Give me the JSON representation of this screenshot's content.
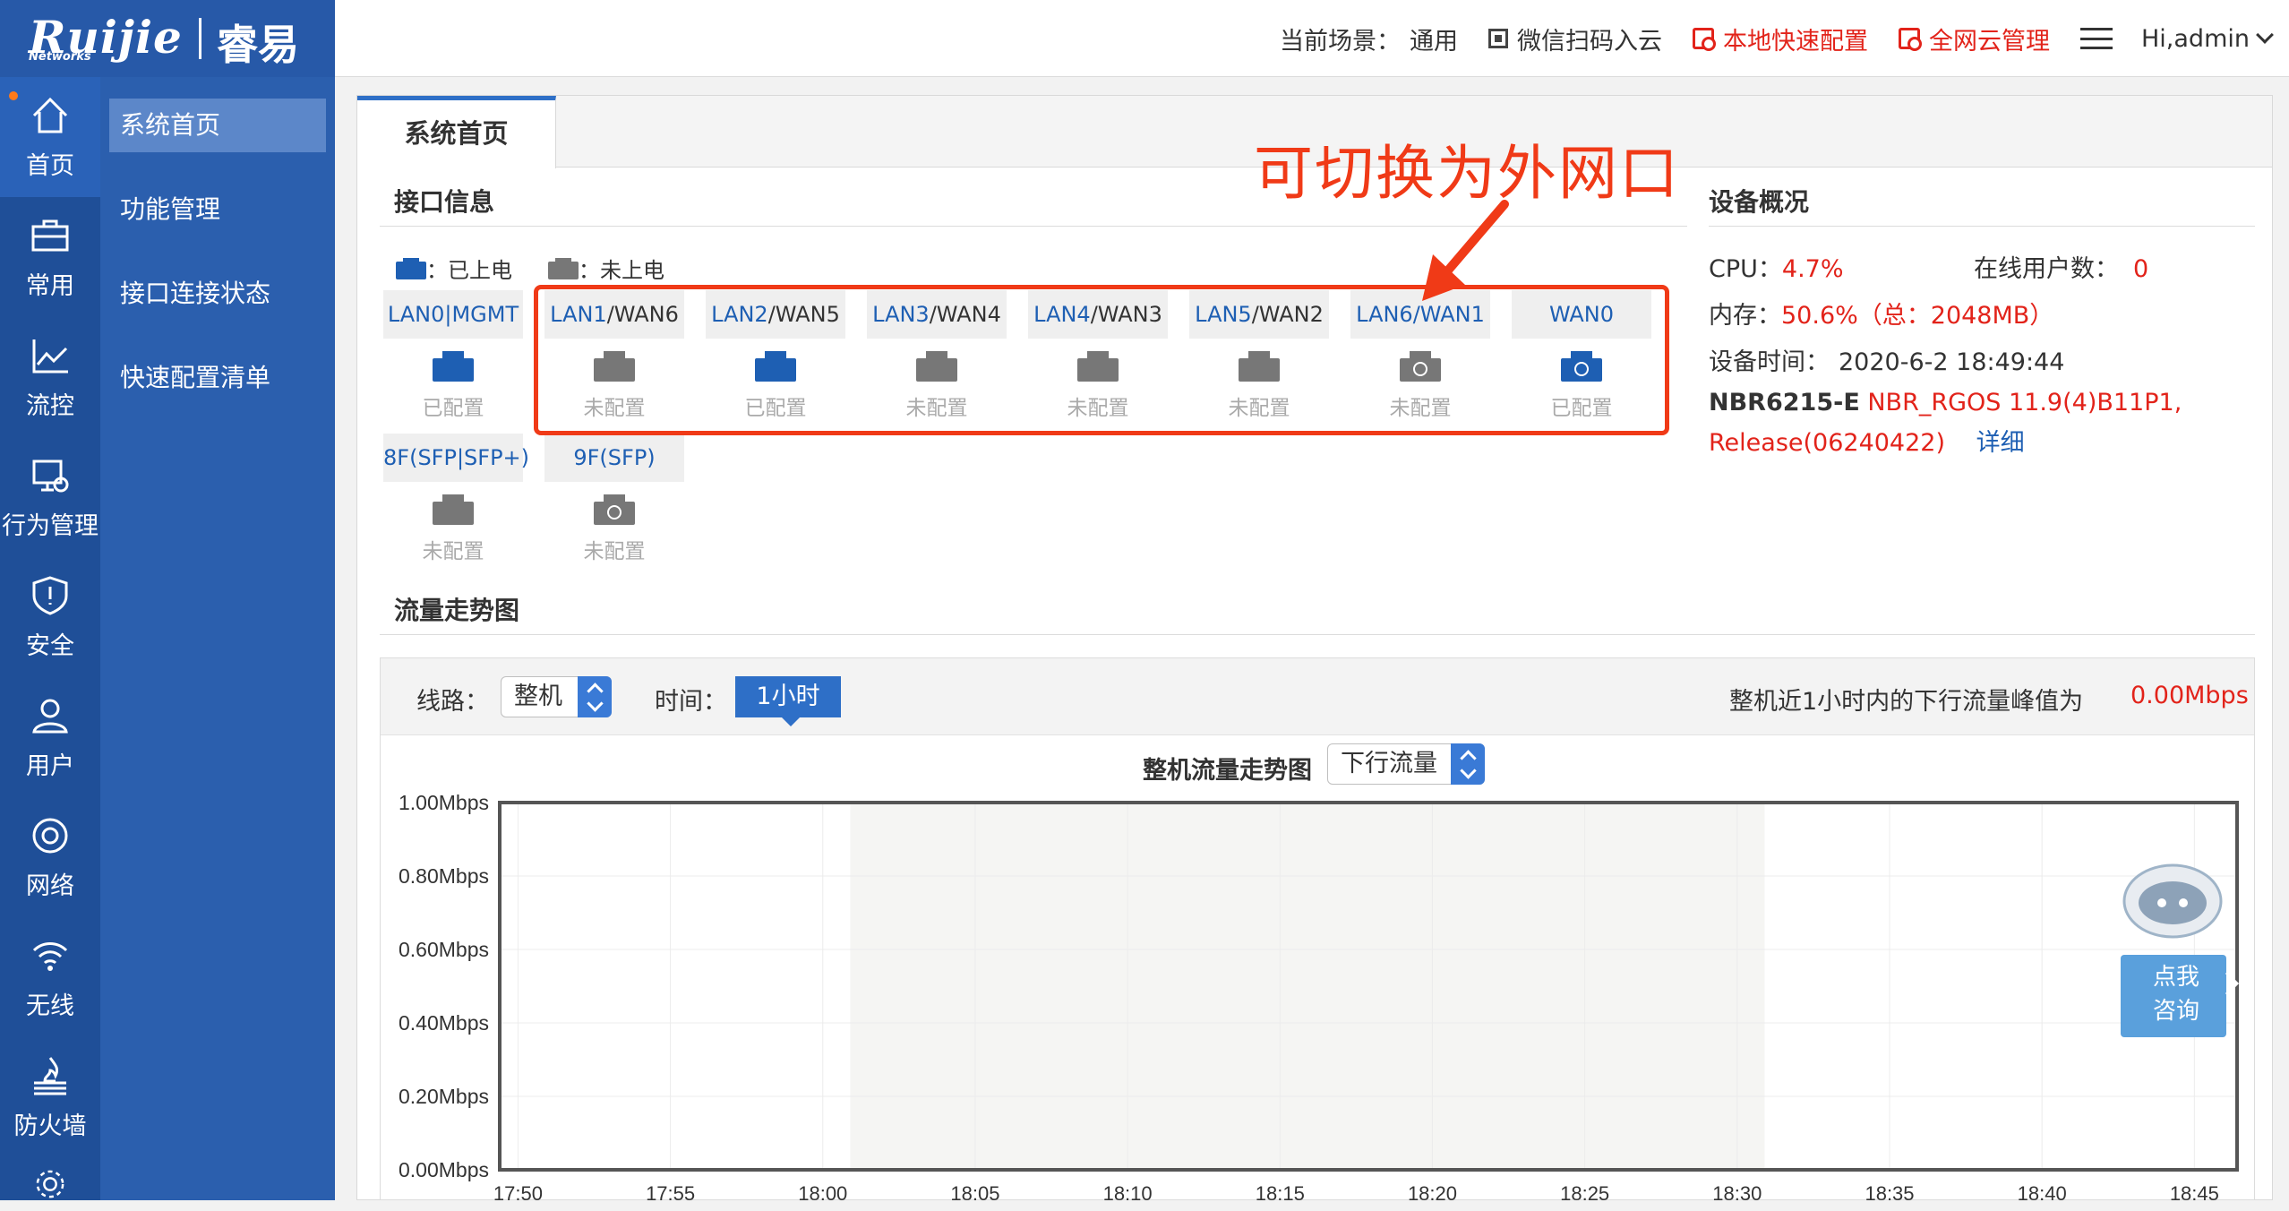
{
  "header": {
    "logo_main": "Ruijie",
    "logo_sub": "Networks",
    "logo_brand": "睿易",
    "scene_label": "当前场景：",
    "scene_value": "通用",
    "wechat": "微信扫码入云",
    "local_config": "本地快速配置",
    "cloud_manage": "全网云管理",
    "user": "Hi,admin"
  },
  "iconbar": [
    {
      "label": "首页",
      "icon": "home-icon"
    },
    {
      "label": "常用",
      "icon": "toolbox-icon"
    },
    {
      "label": "流控",
      "icon": "chart-icon"
    },
    {
      "label": "行为管理",
      "icon": "monitor-icon"
    },
    {
      "label": "安全",
      "icon": "shield-icon"
    },
    {
      "label": "用户",
      "icon": "user-icon"
    },
    {
      "label": "网络",
      "icon": "globe-icon"
    },
    {
      "label": "无线",
      "icon": "wifi-icon"
    },
    {
      "label": "防火墙",
      "icon": "firewall-icon"
    }
  ],
  "subnav": [
    "系统首页",
    "功能管理",
    "接口连接状态",
    "快速配置清单"
  ],
  "tab": "系统首页",
  "interface": {
    "title": "接口信息",
    "legend_on": "：已上电",
    "legend_off": "：未上电",
    "ports_row1": [
      {
        "lan": "LAN0|MGMT",
        "wan": "",
        "status": "已配置",
        "color": "blue",
        "globe": false
      },
      {
        "lan": "LAN1",
        "wan": "/WAN6",
        "status": "未配置",
        "color": "gray",
        "globe": false
      },
      {
        "lan": "LAN2",
        "wan": "/WAN5",
        "status": "已配置",
        "color": "blue",
        "globe": false
      },
      {
        "lan": "LAN3",
        "wan": "/WAN4",
        "status": "未配置",
        "color": "gray",
        "globe": false
      },
      {
        "lan": "LAN4",
        "wan": "/WAN3",
        "status": "未配置",
        "color": "gray",
        "globe": false
      },
      {
        "lan": "LAN5",
        "wan": "/WAN2",
        "status": "未配置",
        "color": "gray",
        "globe": false
      },
      {
        "lan": "LAN6",
        "wan": "/WAN1",
        "status": "未配置",
        "color": "gray",
        "globe": true
      },
      {
        "lan": "WAN0",
        "wan": "",
        "status": "已配置",
        "color": "blue",
        "globe": true
      }
    ],
    "ports_row2": [
      {
        "lan": "8F(SFP|SFP+)",
        "wan": "",
        "status": "未配置",
        "color": "gray",
        "globe": false
      },
      {
        "lan": "9F(SFP)",
        "wan": "",
        "status": "未配置",
        "color": "gray",
        "globe": true
      }
    ]
  },
  "annotation": "可切换为外网口",
  "device": {
    "title": "设备概况",
    "cpu_label": "CPU：",
    "cpu_value": "4.7%",
    "online_label": "在线用户数：",
    "online_value": "0",
    "mem_label": "内存：",
    "mem_value": "50.6%（总：2048MB）",
    "time_label": "设备时间：",
    "time_value": "2020-6-2 18:49:44",
    "model": "NBR6215-E",
    "version": "NBR_RGOS 11.9(4)B11P1,",
    "release": "Release(06240422)",
    "detail": "详细"
  },
  "traffic": {
    "title": "流量走势图",
    "line_label": "线路：",
    "line_value": "整机",
    "time_label": "时间：",
    "time_value": "1小时",
    "peak_text": "整机近1小时内的下行流量峰值为",
    "peak_value": "0.00Mbps",
    "chart_title": "整机流量走势图",
    "direction": "下行流量"
  },
  "robot": {
    "line1": "点我",
    "line2": "咨询"
  },
  "chart_data": {
    "type": "area",
    "title": "整机流量走势图",
    "ylabel": "",
    "yticks": [
      "1.00Mbps",
      "0.80Mbps",
      "0.60Mbps",
      "0.40Mbps",
      "0.20Mbps",
      "0.00Mbps"
    ],
    "x": [
      "17:50",
      "17:55",
      "18:00",
      "18:05",
      "18:10",
      "18:15",
      "18:20",
      "18:25",
      "18:30",
      "18:35",
      "18:40",
      "18:45"
    ],
    "ylim": [
      0,
      1.0
    ],
    "series": [
      {
        "values": [
          0,
          0,
          0,
          0,
          0,
          0,
          0,
          0,
          0,
          0,
          0,
          0
        ]
      }
    ],
    "grid": true
  }
}
